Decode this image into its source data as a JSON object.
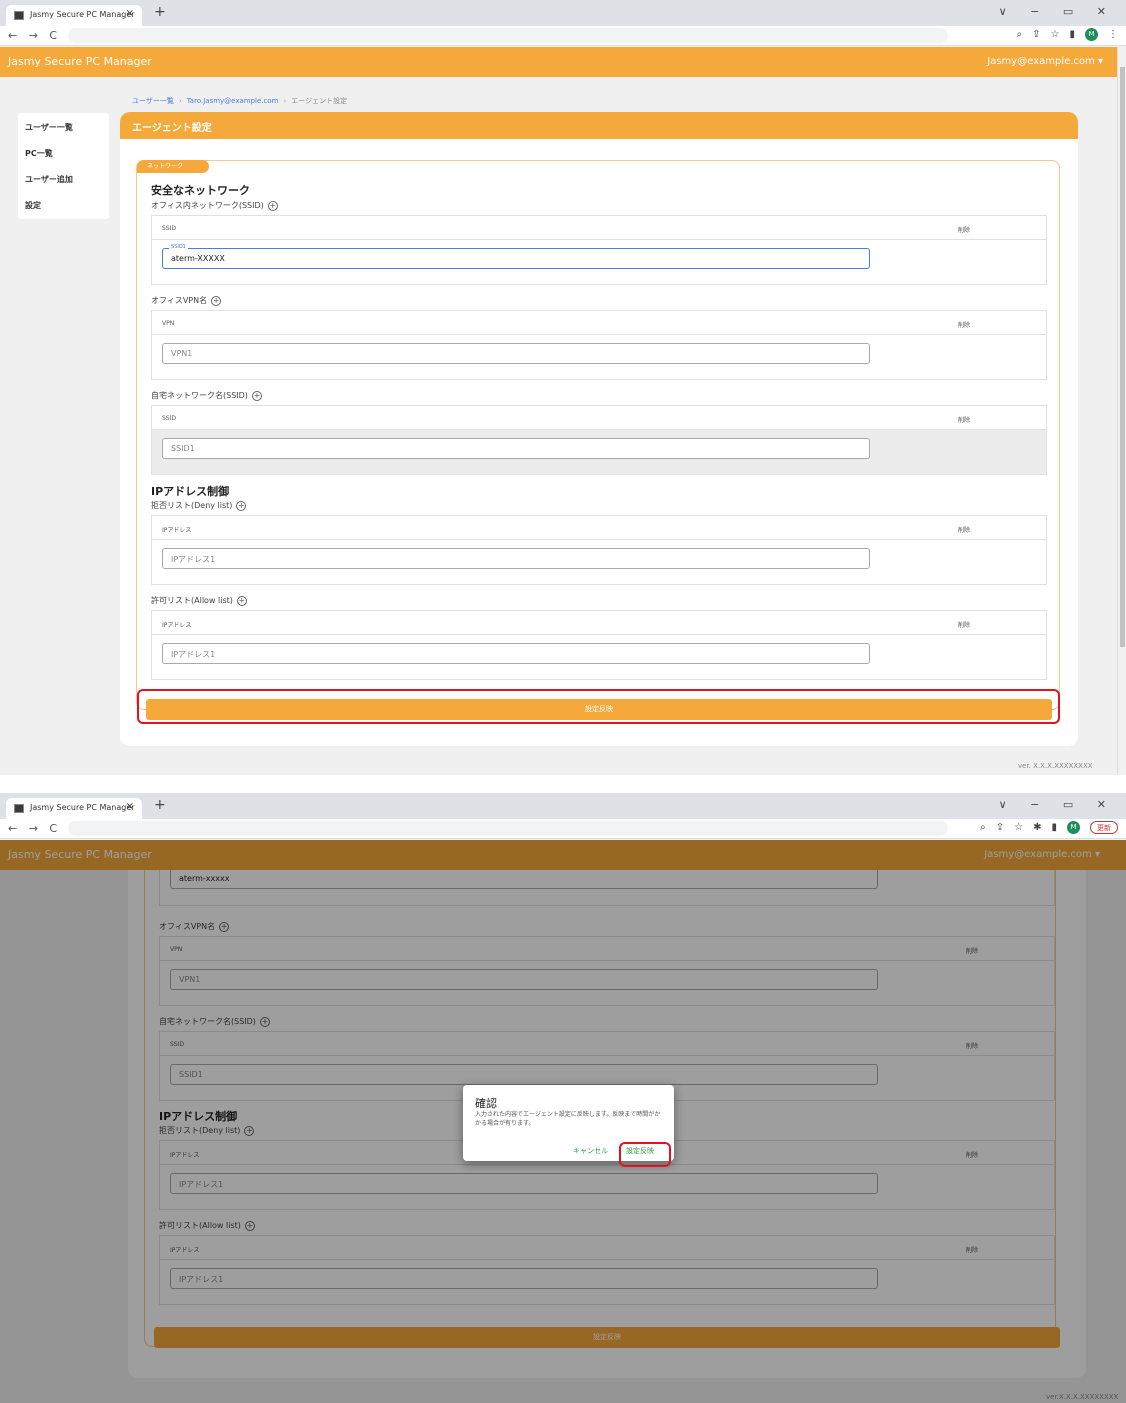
{
  "browser": {
    "tab_title": "Jasmy Secure PC Manager",
    "tab_close": "×",
    "new_tab": "+",
    "window_controls": "∨ − ▭ ✕",
    "nav_buttons": "← → C",
    "avatar_letter": "M",
    "update_button": "更新"
  },
  "app": {
    "brand": "Jasmy Secure PC Manager",
    "user_menu": "Jasmy@example.com ▾",
    "version": "ver. X.X.X.XXXXXXXX",
    "version_2": "ver.X.X.X.XXXXXXXX"
  },
  "sidebar": {
    "items": [
      {
        "label": "ユーザー一覧"
      },
      {
        "label": "PC一覧"
      },
      {
        "label": "ユーザー追加"
      },
      {
        "label": "設定"
      }
    ]
  },
  "breadcrumb": {
    "items": [
      "ユーザー一覧",
      "Taro.Jasmy@example.com",
      "エージェント設定"
    ],
    "separator": "›"
  },
  "page": {
    "title": "エージェント設定",
    "network_pill": "ネットワーク",
    "safe_network_heading": "安全なネットワーク",
    "office_ssid_label": "オフィス内ネットワーク(SSID)",
    "office_vpn_label": "オフィスVPN名",
    "home_ssid_label": "自宅ネットワーク名(SSID)",
    "ip_heading": "IPアドレス制御",
    "deny_label": "拒否リスト(Deny list)",
    "allow_label": "許可リスト(Allow list)",
    "plus": "+",
    "col_ssid": "SSID",
    "col_vpn": "VPN",
    "col_ip": "IPアドレス",
    "col_delete": "削除",
    "office_ssid_value": "aterm-XXXXX",
    "office_ssid_value_2": "aterm-xxxxx",
    "office_ssid_floating": "SSID1",
    "vpn_placeholder": "VPN1",
    "home_ssid_placeholder": "SSID1",
    "deny_ip_placeholder": "IPアドレス1",
    "allow_ip_placeholder": "IPアドレス1",
    "apply_button": "設定反映"
  },
  "dialog": {
    "title": "確認",
    "message": "入力された内容でエージェント設定に反映します。反映まで時間がかかる場合が有ります。",
    "cancel": "キャンセル",
    "ok": "設定反映"
  },
  "colors": {
    "accent": "#f4a93a",
    "highlight": "#e0141e",
    "dialog_action": "#2e9e4a"
  }
}
